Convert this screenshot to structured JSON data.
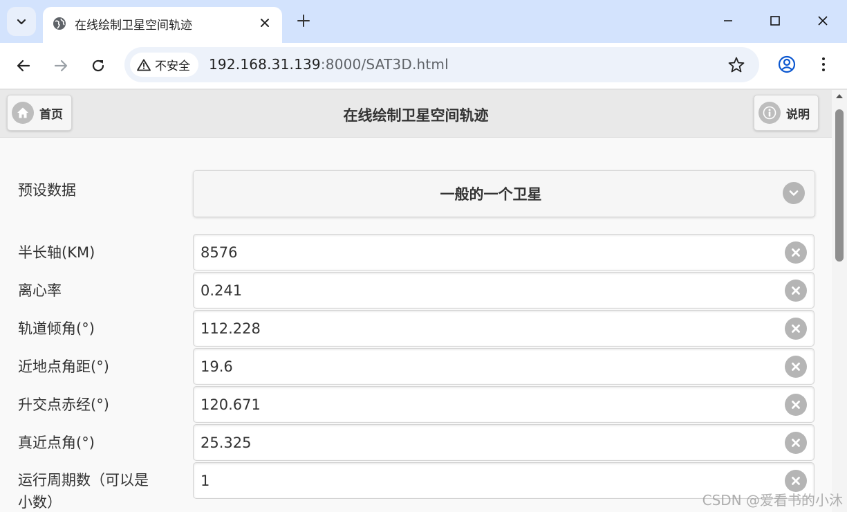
{
  "browser": {
    "tab_title": "在线绘制卫星空间轨迹",
    "security_label": "不安全",
    "url_host": "192.168.31.139",
    "url_rest": ":8000/SAT3D.html"
  },
  "header": {
    "home_label": "首页",
    "title": "在线绘制卫星空间轨迹",
    "help_label": "说明"
  },
  "preset": {
    "label": "预设数据",
    "selected": "一般的一个卫星"
  },
  "fields": [
    {
      "label": "半长轴(KM)",
      "value": "8576"
    },
    {
      "label": "离心率",
      "value": "0.241"
    },
    {
      "label": "轨道倾角(°)",
      "value": "112.228"
    },
    {
      "label": "近地点角距(°)",
      "value": "19.6"
    },
    {
      "label": "升交点赤经(°)",
      "value": "120.671"
    },
    {
      "label": "真近点角(°)",
      "value": "25.325"
    },
    {
      "label_line1": "运行周期数（可以是",
      "label_line2": "小数）",
      "value": "1"
    }
  ],
  "watermark": "CSDN @爱看书的小沐",
  "icons": {
    "tab_search": "chevron-down-icon",
    "favicon": "globe-icon",
    "warning": "warning-triangle-icon",
    "home": "home-icon",
    "info": "info-icon",
    "clear": "clear-x-icon"
  }
}
